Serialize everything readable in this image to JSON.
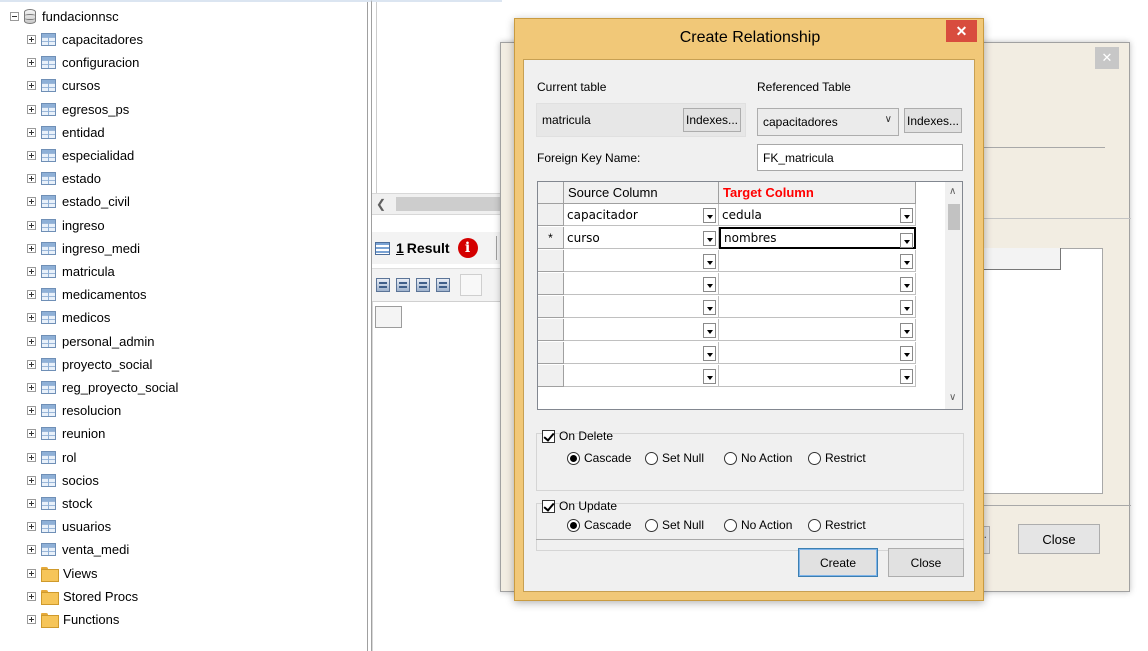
{
  "tree": {
    "root": "fundacionnsc",
    "tables": [
      "capacitadores",
      "configuracion",
      "cursos",
      "egresos_ps",
      "entidad",
      "especialidad",
      "estado",
      "estado_civil",
      "ingreso",
      "ingreso_medi",
      "matricula",
      "medicamentos",
      "medicos",
      "personal_admin",
      "proyecto_social",
      "reg_proyecto_social",
      "resolucion",
      "reunion",
      "rol",
      "socios",
      "stock",
      "usuarios",
      "venta_medi"
    ],
    "folders": [
      "Views",
      "Stored Procs",
      "Functions"
    ]
  },
  "results": {
    "tab_number": "1",
    "tab_label": "Result",
    "info_icon": "i"
  },
  "background_dialog": {
    "close_label": "Close",
    "partial_label": "..."
  },
  "dialog": {
    "title": "Create Relationship",
    "close_glyph": "✕",
    "current_table_label": "Current table",
    "current_table_value": "matricula",
    "indexes_label": "Indexes...",
    "referenced_table_label": "Referenced Table",
    "referenced_table_value": "capacitadores",
    "fk_name_label": "Foreign Key Name:",
    "fk_name_value": "FK_matricula",
    "grid": {
      "source_header": "Source Column",
      "target_header": "Target Column",
      "rows": [
        {
          "marker": "",
          "source": "capacitador",
          "target": "cedula"
        },
        {
          "marker": "*",
          "source": "curso",
          "target": "nombres"
        },
        {
          "marker": "",
          "source": "",
          "target": ""
        },
        {
          "marker": "",
          "source": "",
          "target": ""
        },
        {
          "marker": "",
          "source": "",
          "target": ""
        },
        {
          "marker": "",
          "source": "",
          "target": ""
        },
        {
          "marker": "",
          "source": "",
          "target": ""
        },
        {
          "marker": "",
          "source": "",
          "target": ""
        }
      ]
    },
    "on_delete": {
      "label": "On Delete",
      "checked": true,
      "options": [
        "Cascade",
        "Set Null",
        "No Action",
        "Restrict"
      ],
      "selected": "Cascade"
    },
    "on_update": {
      "label": "On Update",
      "checked": true,
      "options": [
        "Cascade",
        "Set Null",
        "No Action",
        "Restrict"
      ],
      "selected": "Cascade"
    },
    "create_label": "Create",
    "close_label": "Close"
  },
  "colors": {
    "dialog_frame": "#f1c878",
    "close_button": "#d84c3e",
    "target_header_text": "#ff0000",
    "error_icon": "#d40000"
  }
}
